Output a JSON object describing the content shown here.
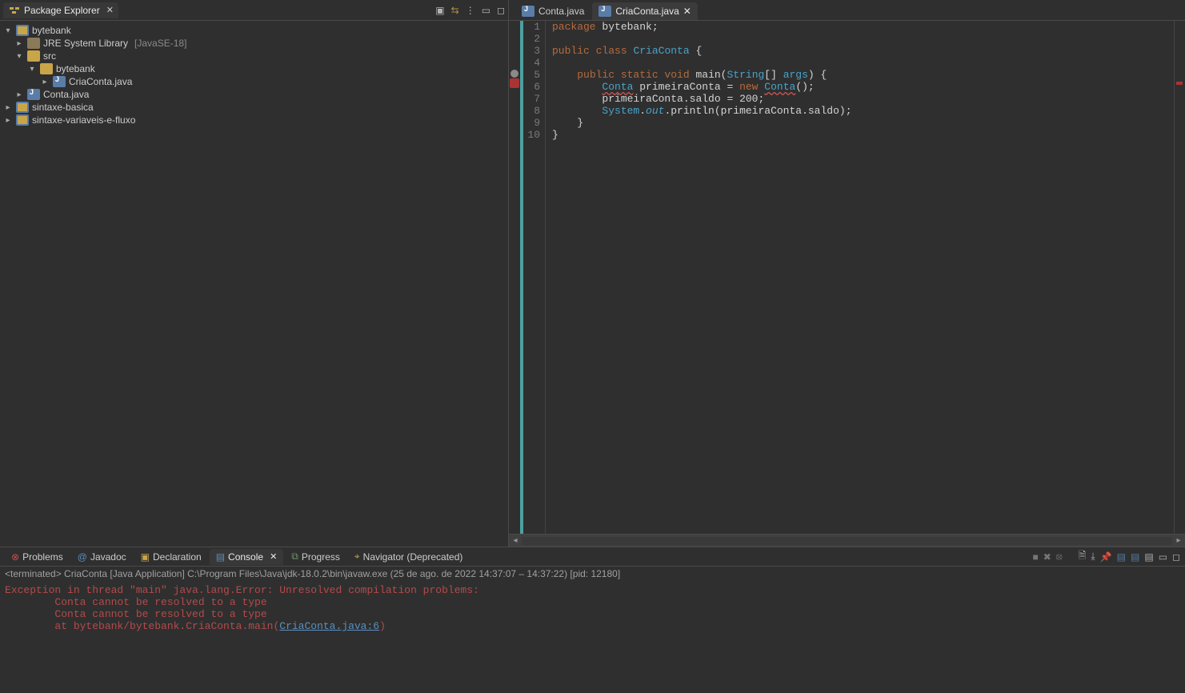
{
  "left": {
    "title": "Package Explorer",
    "tree": {
      "proj1": "bytebank",
      "jre": "JRE System Library",
      "jre_extra": "[JavaSE-18]",
      "src": "src",
      "pkg": "bytebank",
      "file1": "CriaConta.java",
      "file2": "Conta.java",
      "proj2": "sintaxe-basica",
      "proj3": "sintaxe-variaveis-e-fluxo"
    }
  },
  "editor": {
    "tab_inactive": "Conta.java",
    "tab_active": "CriaConta.java",
    "lines": {
      "1": "package bytebank;",
      "2": "",
      "3": "public class CriaConta {",
      "4": "",
      "5": "    public static void main(String[] args) {",
      "6": "        Conta primeiraConta = new Conta();",
      "7": "        primeiraConta.saldo = 200;",
      "8": "        System.out.println(primeiraConta.saldo);",
      "9": "    }",
      "10": "}"
    }
  },
  "bottom": {
    "tabs": {
      "problems": "Problems",
      "javadoc": "Javadoc",
      "declaration": "Declaration",
      "console": "Console",
      "progress": "Progress",
      "navigator": "Navigator (Deprecated)"
    },
    "console_title": "<terminated> CriaConta [Java Application] C:\\Program Files\\Java\\jdk-18.0.2\\bin\\javaw.exe  (25 de ago. de 2022 14:37:07 – 14:37:22) [pid: 12180]",
    "console_lines": {
      "l1": "Exception in thread \"main\" java.lang.Error: Unresolved compilation problems: ",
      "l2": "        Conta cannot be resolved to a type",
      "l3": "        Conta cannot be resolved to a type",
      "l4": "",
      "l5_pre": "        at bytebank/bytebank.CriaConta.main(",
      "l5_link": "CriaConta.java:6",
      "l5_post": ")"
    }
  }
}
